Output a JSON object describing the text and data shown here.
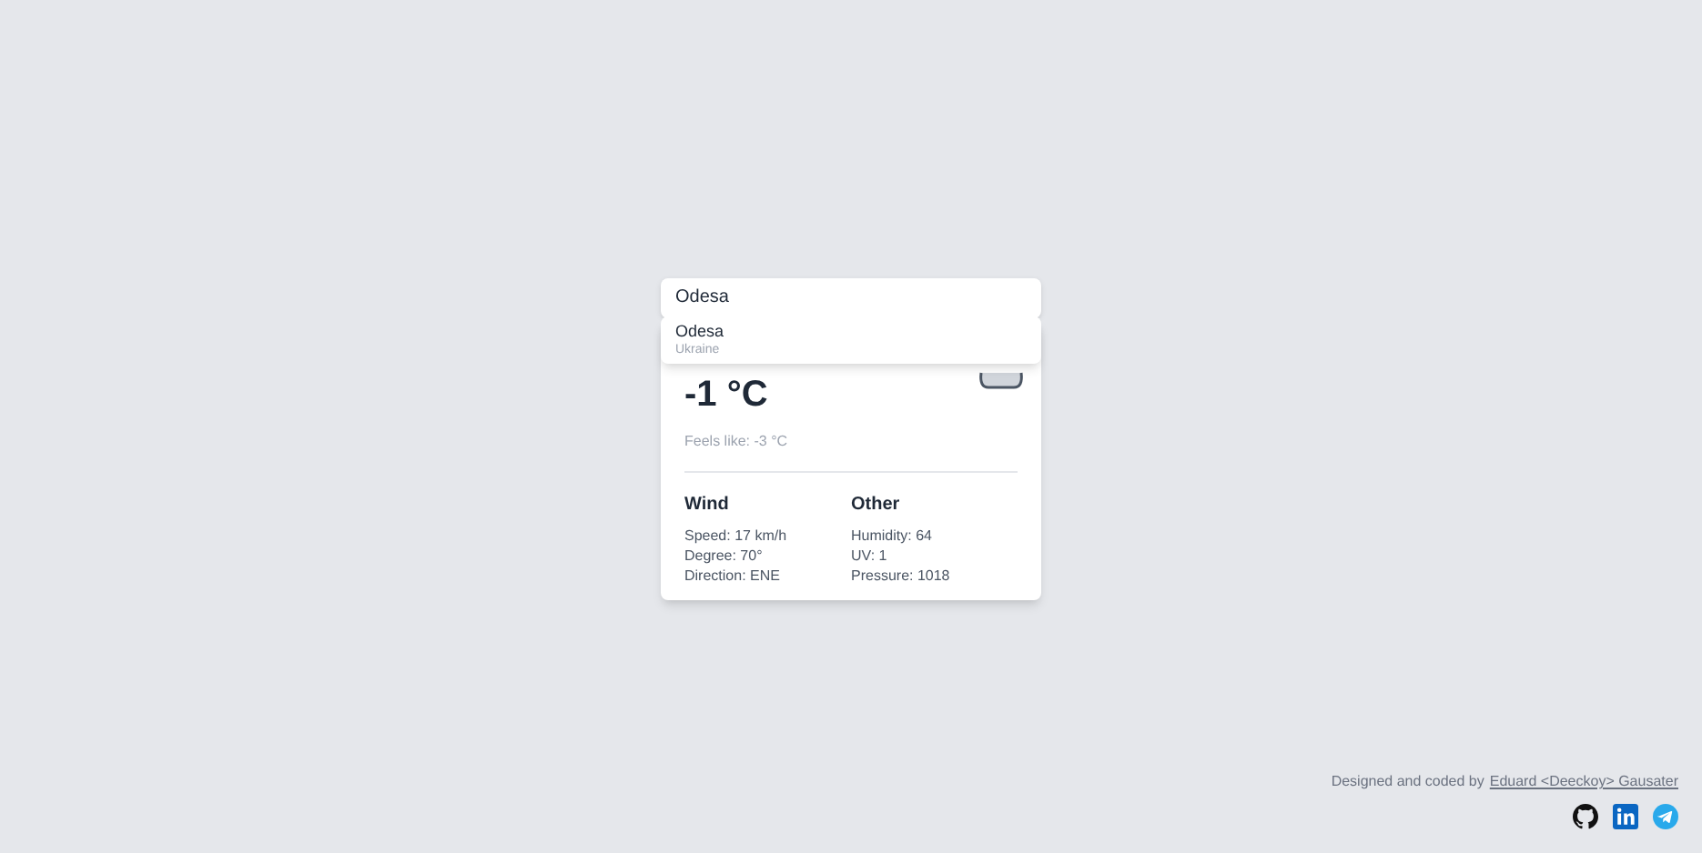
{
  "search": {
    "value": "Odesa"
  },
  "suggestions": [
    {
      "city": "Odesa",
      "country": "Ukraine"
    }
  ],
  "weather": {
    "temperature": "-1 °C",
    "feels_like": "Feels like: -3 °C",
    "sections": [
      {
        "title": "Wind",
        "lines": [
          "Speed: 17 km/h",
          "Degree: 70°",
          "Direction: ENE"
        ]
      },
      {
        "title": "Other",
        "lines": [
          "Humidity: 64",
          "UV: 1",
          "Pressure: 1018"
        ]
      }
    ]
  },
  "footer": {
    "text": "Designed and coded by",
    "link": "Eduard <Deeckoy> Gausater"
  }
}
